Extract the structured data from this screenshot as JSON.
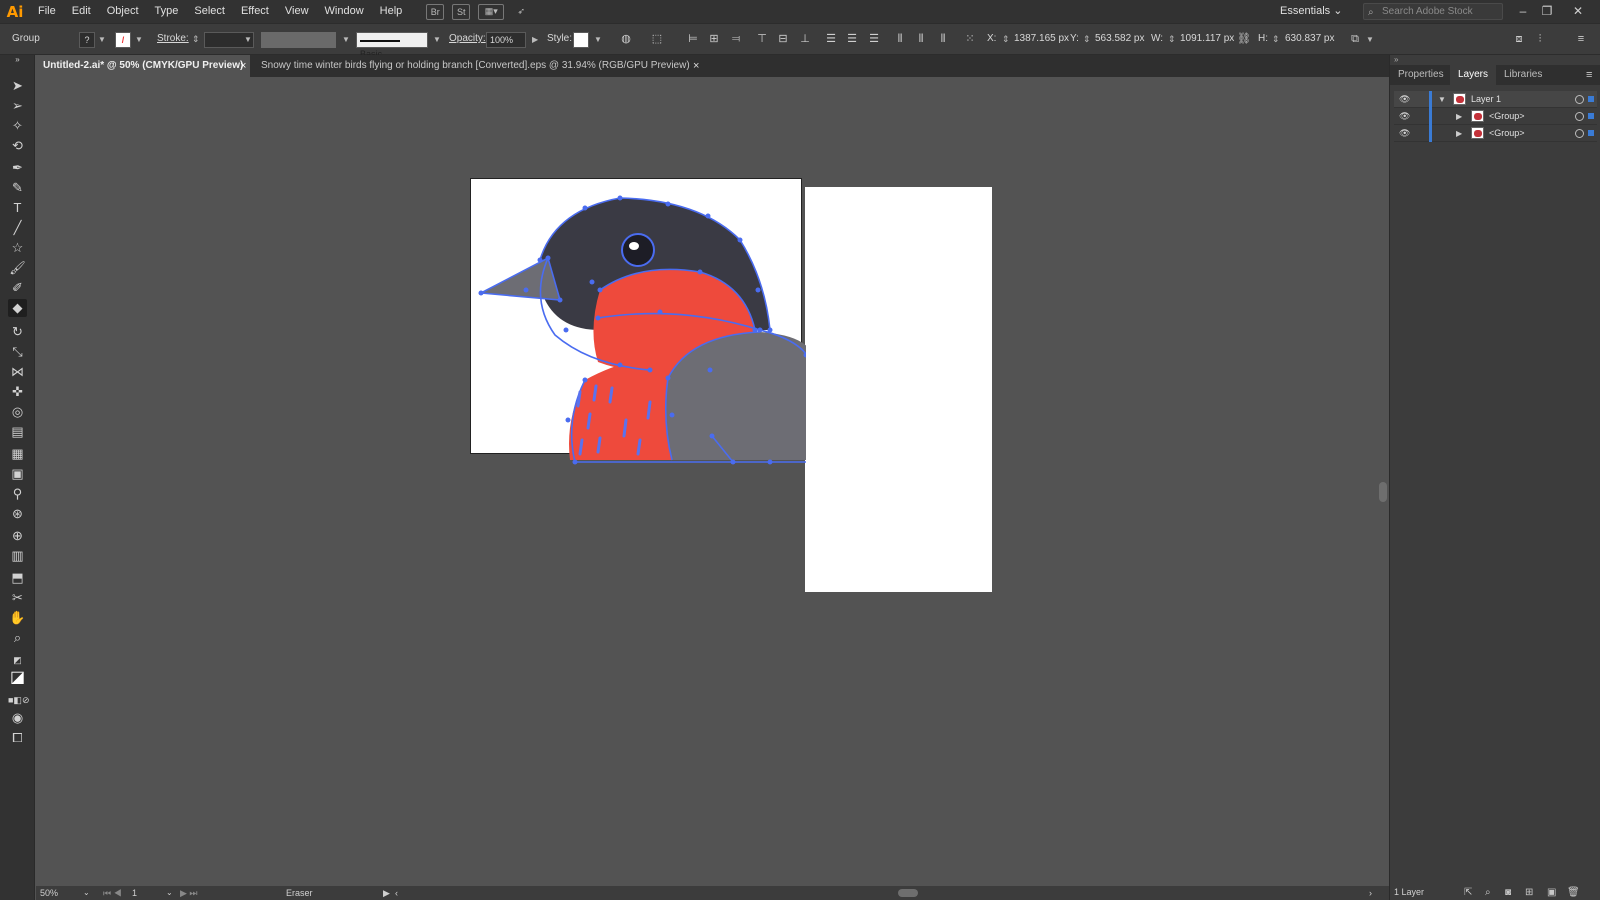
{
  "app": {
    "logo": "Ai"
  },
  "menu": [
    "File",
    "Edit",
    "Object",
    "Type",
    "Select",
    "Effect",
    "View",
    "Window",
    "Help"
  ],
  "menubar_icons": {
    "br": "Br",
    "st": "St"
  },
  "workspace": "Essentials",
  "stock_search": {
    "placeholder": "Search Adobe Stock"
  },
  "control": {
    "selection": "Group",
    "stroke_label": "Stroke:",
    "brush": "Basic",
    "opacity_label": "Opacity:",
    "opacity": "100%",
    "style_label": "Style:",
    "x_label": "X:",
    "x": "1387.165 px",
    "y_label": "Y:",
    "y": "563.582 px",
    "w_label": "W:",
    "w": "1091.117 px",
    "h_label": "H:",
    "h": "630.837 px"
  },
  "tabs": [
    {
      "label": "Untitled-2.ai* @ 50% (CMYK/GPU Preview)"
    },
    {
      "label": "Snowy time winter birds flying or holding branch [Converted].eps @ 31.94% (RGB/GPU Preview)"
    }
  ],
  "active_tool": "eraser-tool",
  "status": {
    "zoom": "50%",
    "artboard": "1",
    "tool": "Eraser"
  },
  "panel": {
    "tabs": [
      "Properties",
      "Layers",
      "Libraries"
    ],
    "layers": [
      {
        "name": "Layer 1"
      },
      {
        "name": "<Group>"
      },
      {
        "name": "<Group>"
      }
    ],
    "footer": "1 Layer"
  },
  "colors": {
    "bird_red": "#ee4a3c",
    "bird_dark": "#3a3a44",
    "bird_gray": "#6d6d74",
    "path_blue": "#4a6cf0",
    "layer_accent": "#3a7bd5",
    "logo_orange": "#ff9a00"
  }
}
